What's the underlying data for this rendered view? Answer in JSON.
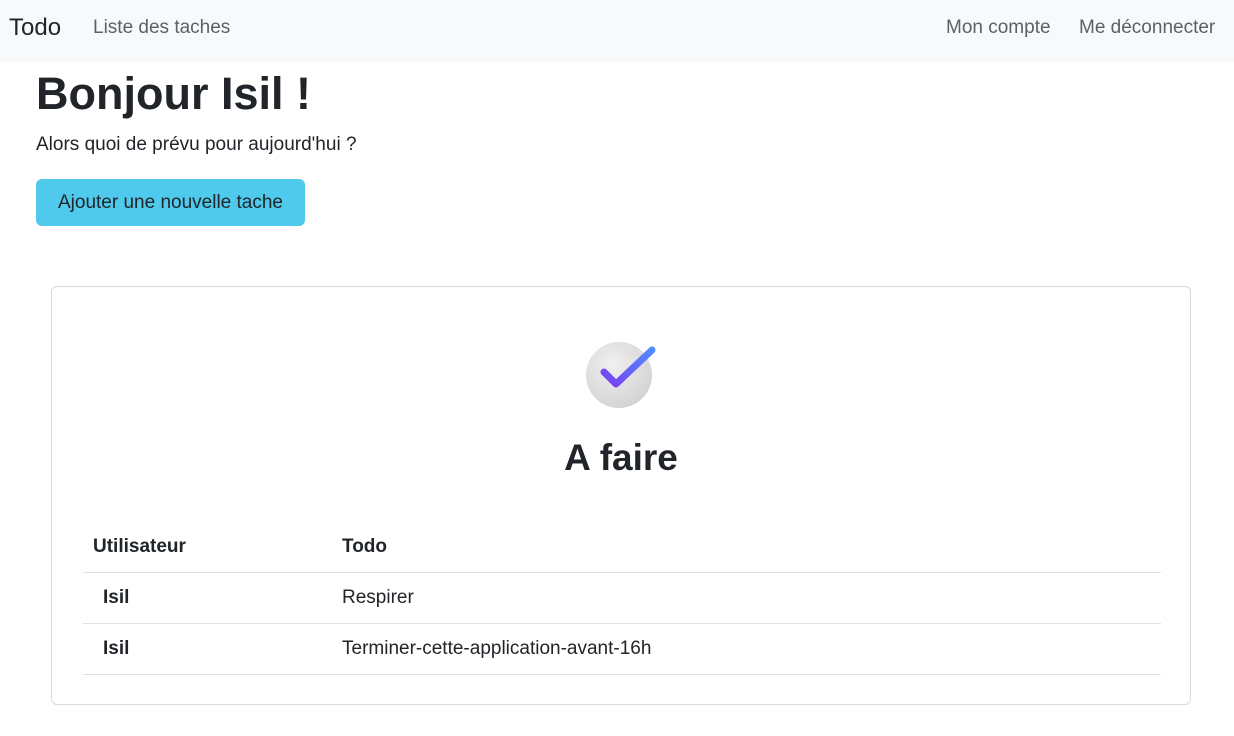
{
  "navbar": {
    "brand": "Todo",
    "links": {
      "tasks": "Liste des taches",
      "account": "Mon compte",
      "logout": "Me déconnecter"
    }
  },
  "greeting": "Bonjour Isil !",
  "subtitle": "Alors quoi de prévu pour aujourd'hui ?",
  "add_button": "Ajouter une nouvelle tache",
  "card": {
    "title": "A faire",
    "icon": "check-icon",
    "table": {
      "headers": [
        "Utilisateur",
        "Todo"
      ],
      "rows": [
        {
          "user": "Isil",
          "todo": "Respirer"
        },
        {
          "user": "Isil",
          "todo": "Terminer-cette-application-avant-16h"
        }
      ]
    }
  },
  "colors": {
    "navbar_bg": "#f8f9fa",
    "button_bg": "#4fc9ec",
    "check_gradient_start": "#7b3ff2",
    "check_gradient_end": "#4f8cff"
  }
}
